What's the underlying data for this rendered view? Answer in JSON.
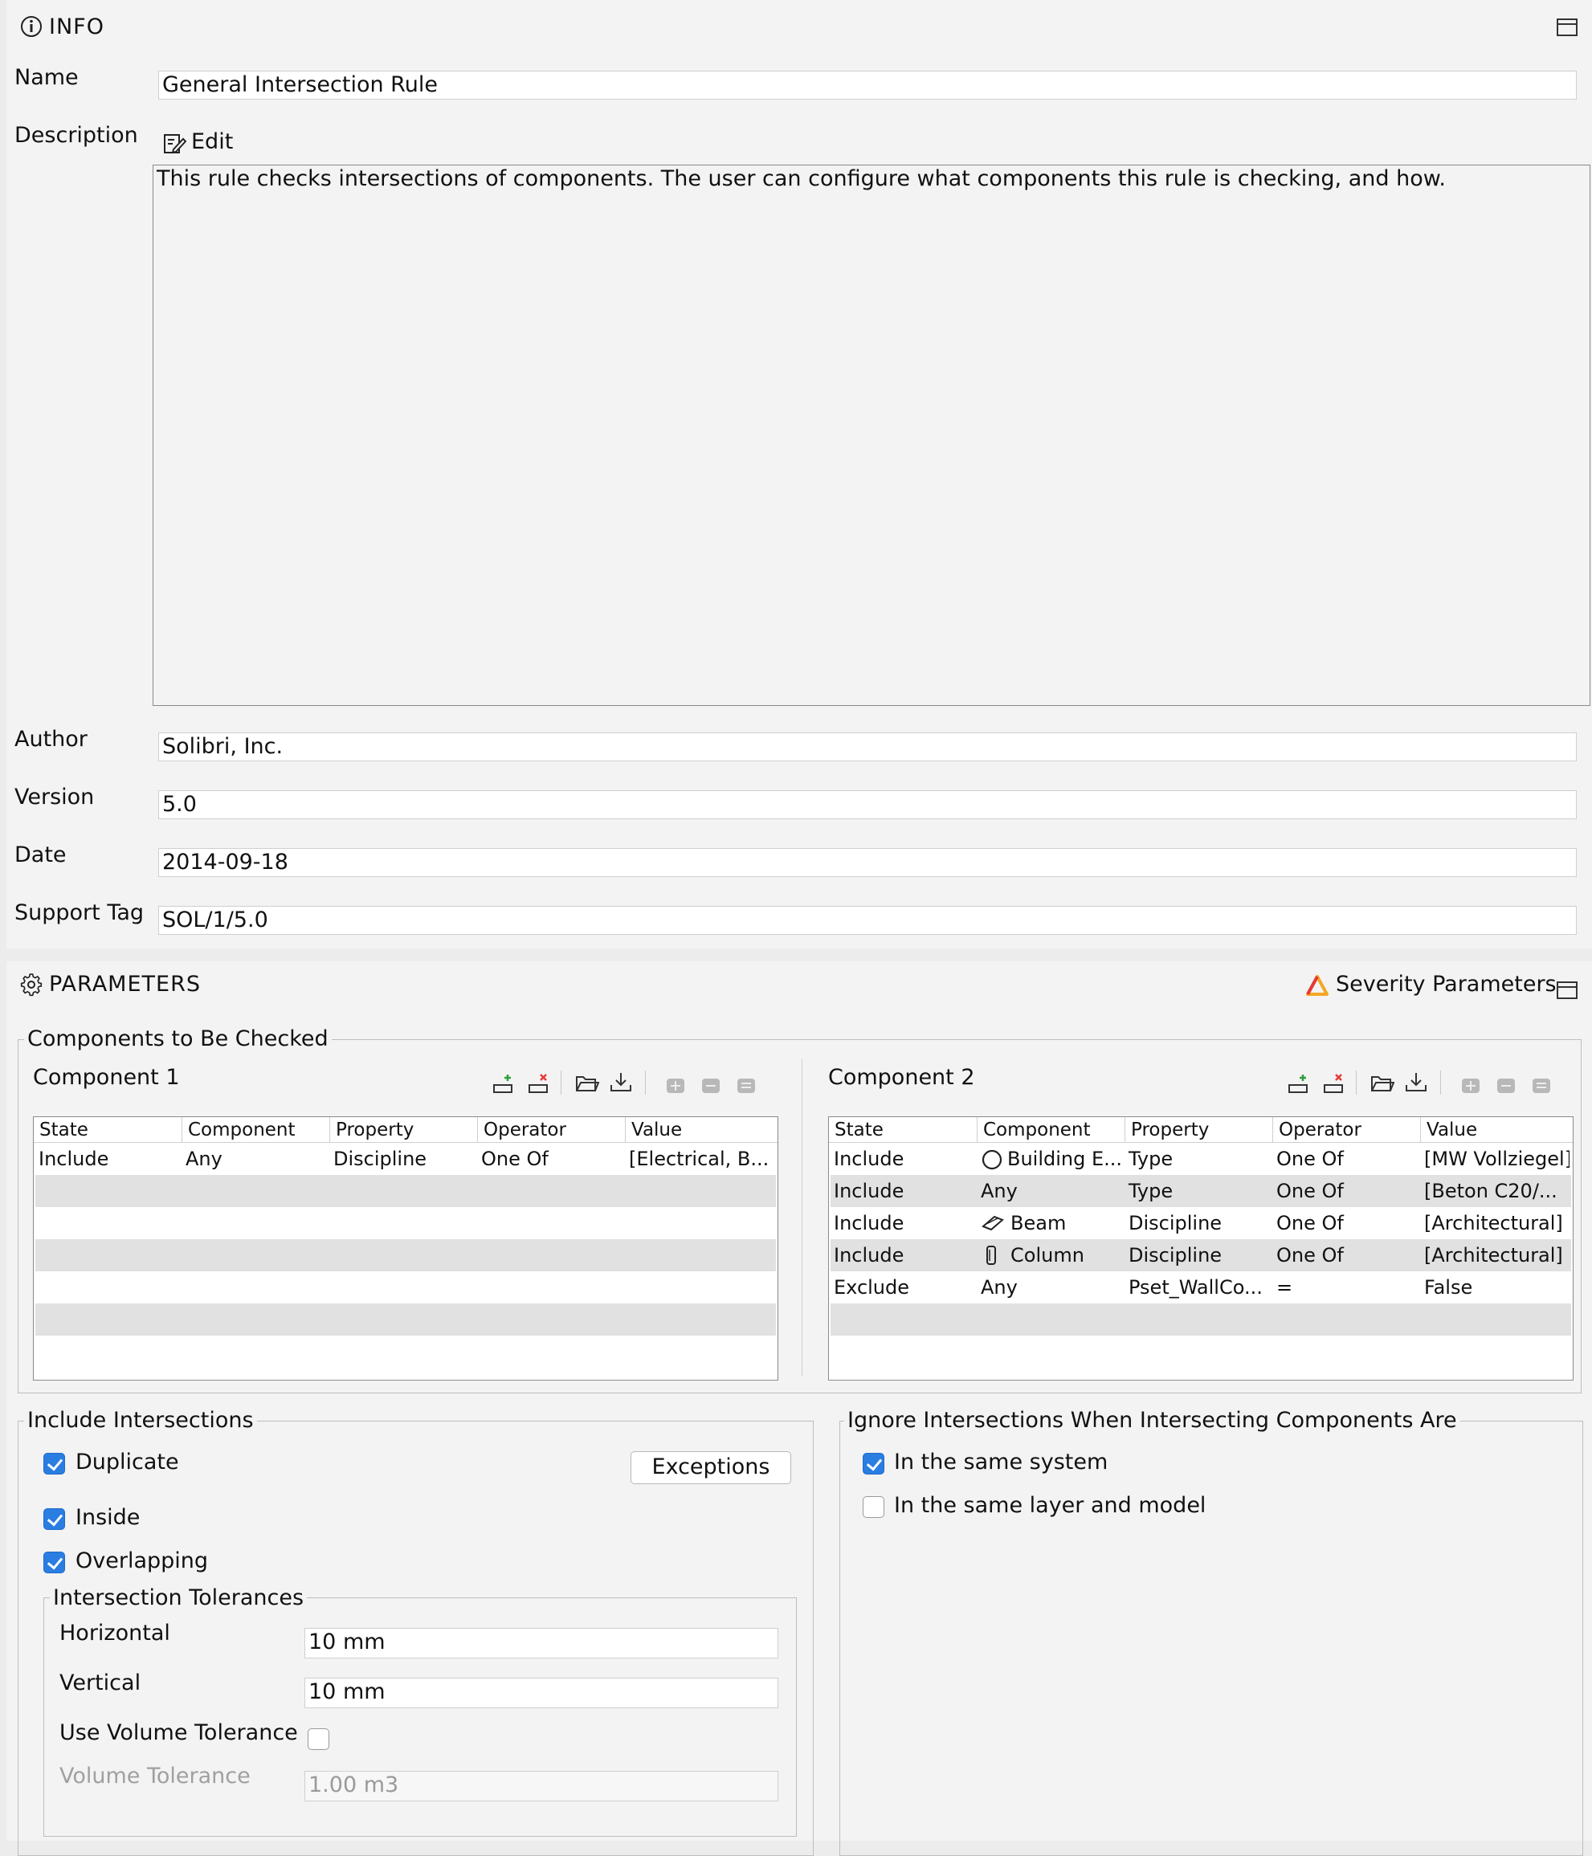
{
  "info": {
    "header": "INFO",
    "name_label": "Name",
    "name_value": "General Intersection Rule",
    "description_label": "Description",
    "edit_label": "Edit",
    "description_text": "This rule checks intersections of components. The user can configure what components this rule is checking, and how.",
    "author_label": "Author",
    "author_value": "Solibri, Inc.",
    "version_label": "Version",
    "version_value": "5.0",
    "date_label": "Date",
    "date_value": "2014-09-18",
    "support_label": "Support Tag",
    "support_value": "SOL/1/5.0"
  },
  "parameters": {
    "header": "PARAMETERS",
    "severity_label": "Severity Parameters",
    "components_group": "Components to Be Checked",
    "component1": {
      "title": "Component 1",
      "columns": [
        "State",
        "Component",
        "Property",
        "Operator",
        "Value"
      ],
      "rows": [
        [
          "Include",
          "Any",
          "Discipline",
          "One Of",
          "[Electrical, B..."
        ]
      ]
    },
    "component2": {
      "title": "Component 2",
      "columns": [
        "State",
        "Component",
        "Property",
        "Operator",
        "Value"
      ],
      "rows": [
        [
          "Include",
          "Building E...",
          "Type",
          "One Of",
          "[MW Vollziegel]"
        ],
        [
          "Include",
          "Any",
          "Type",
          "One Of",
          "[Beton C20/..."
        ],
        [
          "Include",
          "Beam",
          "Discipline",
          "One Of",
          "[Architectural]"
        ],
        [
          "Include",
          "Column",
          "Discipline",
          "One Of",
          "[Architectural]"
        ],
        [
          "Exclude",
          "Any",
          "Pset_WallCo...",
          "=",
          "False"
        ]
      ],
      "row_icons": [
        "building-element-icon",
        "",
        "beam-icon",
        "column-icon",
        ""
      ]
    },
    "include_group": "Include Intersections",
    "duplicate_label": "Duplicate",
    "duplicate_checked": true,
    "exceptions_label": "Exceptions",
    "inside_label": "Inside",
    "inside_checked": true,
    "overlapping_label": "Overlapping",
    "overlapping_checked": true,
    "tolerances_group": "Intersection Tolerances",
    "horizontal_label": "Horizontal",
    "horizontal_value": "10 mm",
    "vertical_label": "Vertical",
    "vertical_value": "10 mm",
    "use_volume_label": "Use Volume Tolerance",
    "use_volume_checked": false,
    "volume_label": "Volume Tolerance",
    "volume_value": "1.00 m3",
    "ignore_group": "Ignore Intersections When Intersecting Components Are",
    "same_system_label": "In the same system",
    "same_system_checked": true,
    "same_layer_label": "In the same layer and model",
    "same_layer_checked": false
  },
  "colors": {
    "accent": "#2a7de1",
    "panel": "#f3f3f3",
    "severity_warning": "#f5a623"
  }
}
